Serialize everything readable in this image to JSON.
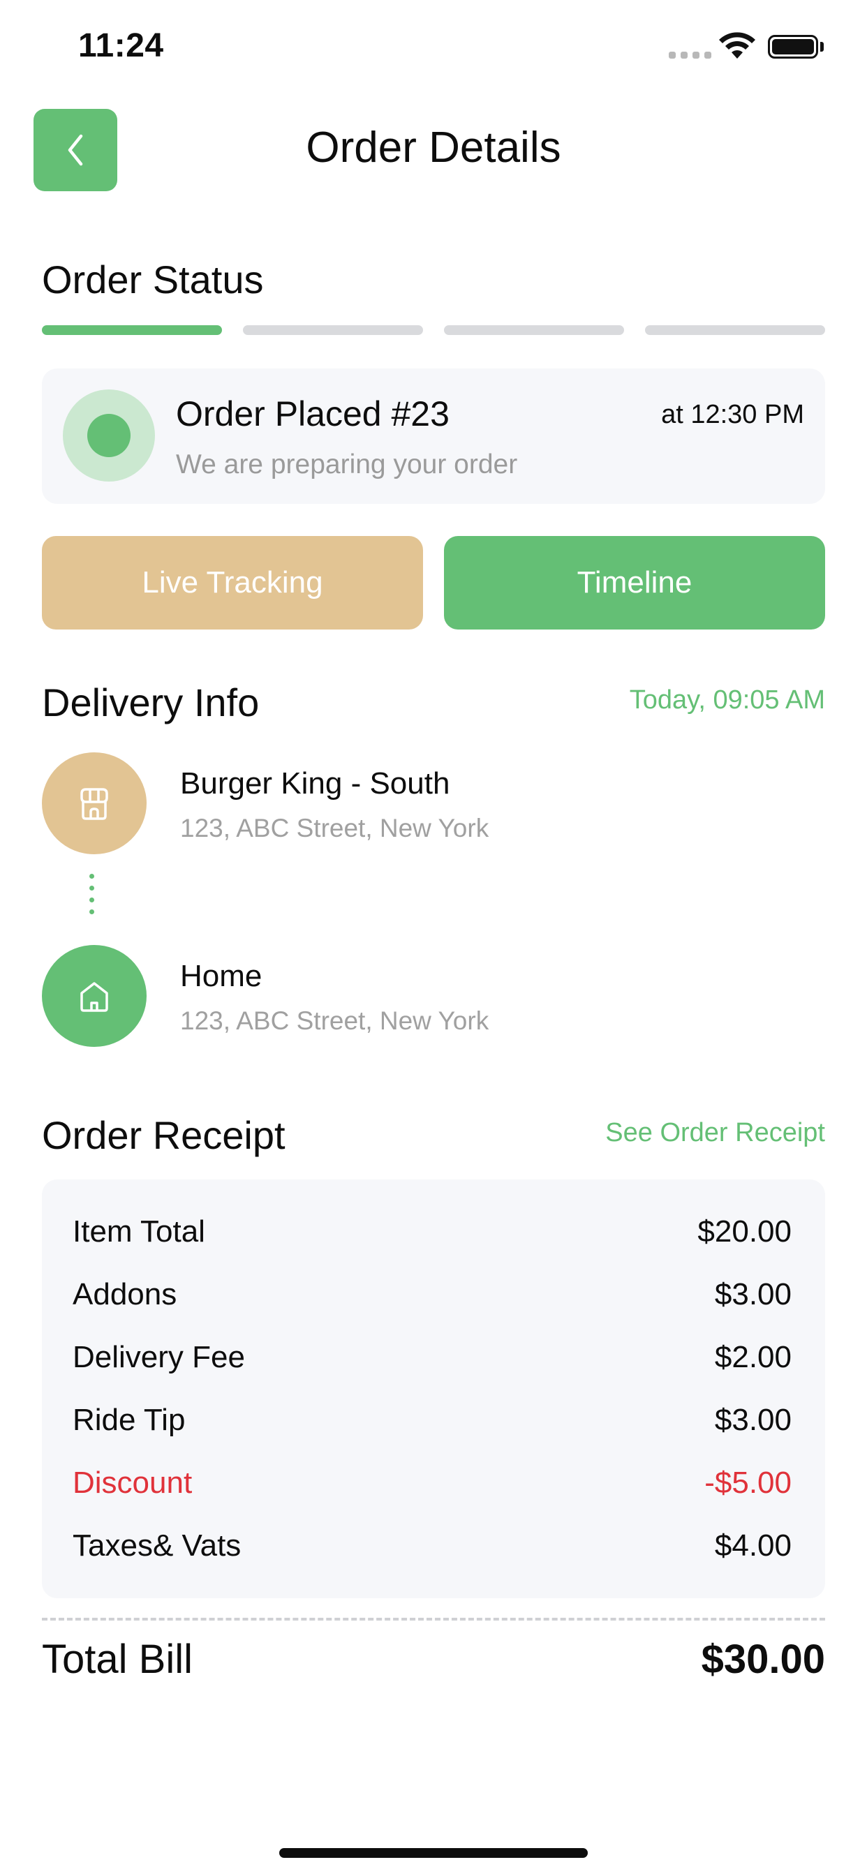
{
  "status_bar": {
    "time": "11:24"
  },
  "header": {
    "title": "Order Details",
    "back_icon": "chevron-left-icon"
  },
  "order_status": {
    "title": "Order Status",
    "progress_steps_total": 4,
    "progress_steps_completed": 1,
    "order_title": "Order Placed #23",
    "order_subtitle": "We are preparing your order",
    "order_time": "at 12:30 PM"
  },
  "actions": {
    "live_tracking": "Live Tracking",
    "timeline": "Timeline"
  },
  "delivery_info": {
    "title": "Delivery Info",
    "time": "Today, 09:05 AM",
    "from": {
      "name": "Burger King - South",
      "address": "123, ABC Street, New York",
      "icon": "store-icon"
    },
    "to": {
      "name": "Home",
      "address": "123, ABC Street, New York",
      "icon": "home-icon"
    }
  },
  "receipt": {
    "title": "Order Receipt",
    "link": "See Order Receipt",
    "rows": [
      {
        "label": "Item Total",
        "value": "$20.00"
      },
      {
        "label": "Addons",
        "value": "$3.00"
      },
      {
        "label": "Delivery Fee",
        "value": "$2.00"
      },
      {
        "label": "Ride Tip",
        "value": "$3.00"
      },
      {
        "label": "Discount",
        "value": "-$5.00"
      },
      {
        "label": "Taxes& Vats",
        "value": "$4.00"
      }
    ],
    "total_label": "Total Bill",
    "total_value": "$30.00"
  },
  "colors": {
    "accent": "#64bf75",
    "secondary": "#e2c493",
    "danger": "#e0323a"
  }
}
